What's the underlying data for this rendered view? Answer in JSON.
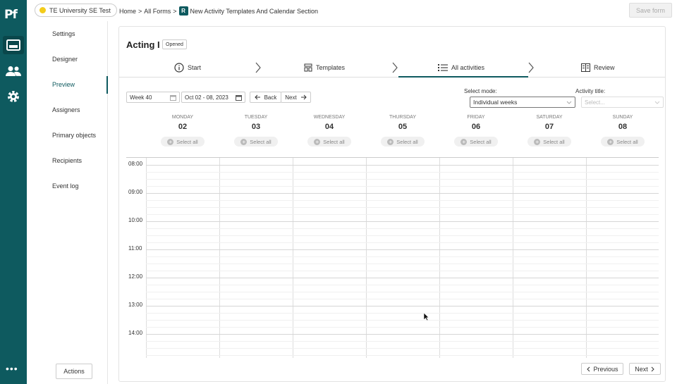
{
  "app": {
    "logo": "Pf"
  },
  "rail": {
    "icons": [
      "form-layout-icon",
      "people-icon",
      "gear-icon"
    ],
    "more_label": "•••"
  },
  "topbar": {
    "org": "TE University SE Test",
    "breadcrumb": {
      "home": "Home",
      "sep1": ">",
      "forms": "All Forms",
      "sep2": ">",
      "badge": "R",
      "current": "New Activity Templates And Calendar Section"
    },
    "save_label": "Save form"
  },
  "sidebar": {
    "items": [
      {
        "label": "Settings"
      },
      {
        "label": "Designer"
      },
      {
        "label": "Preview"
      },
      {
        "label": "Assigners"
      },
      {
        "label": "Primary objects"
      },
      {
        "label": "Recipients"
      },
      {
        "label": "Event log"
      }
    ],
    "actions_label": "Actions"
  },
  "form": {
    "title": "Acting I",
    "status": "Opened",
    "steps": [
      {
        "label": "Start",
        "icon": "info-icon"
      },
      {
        "label": "Templates",
        "icon": "templates-icon"
      },
      {
        "label": "All activities",
        "icon": "list-icon"
      },
      {
        "label": "Review",
        "icon": "review-icon"
      }
    ]
  },
  "toolbar": {
    "week": "Week 40",
    "date_range": "Oct 02 - 08, 2023",
    "back_label": "Back",
    "next_label": "Next",
    "select_mode_label": "Select mode:",
    "select_mode_value": "Individual weeks",
    "activity_title_label": "Activity title:",
    "activity_title_placeholder": "Select..."
  },
  "calendar": {
    "days": [
      {
        "name": "MONDAY",
        "num": "02"
      },
      {
        "name": "TUESDAY",
        "num": "03"
      },
      {
        "name": "WEDNESDAY",
        "num": "04"
      },
      {
        "name": "THURSDAY",
        "num": "05"
      },
      {
        "name": "FRIDAY",
        "num": "06"
      },
      {
        "name": "SATURDAY",
        "num": "07"
      },
      {
        "name": "SUNDAY",
        "num": "08"
      }
    ],
    "select_all_label": "Select all",
    "times": [
      "08:00",
      "09:00",
      "10:00",
      "11:00",
      "12:00",
      "13:00",
      "14:00"
    ]
  },
  "pager": {
    "previous_label": "Previous",
    "next_label": "Next"
  },
  "colors": {
    "brand": "#0e5a5f",
    "accent_yellow": "#f3cc1b"
  }
}
